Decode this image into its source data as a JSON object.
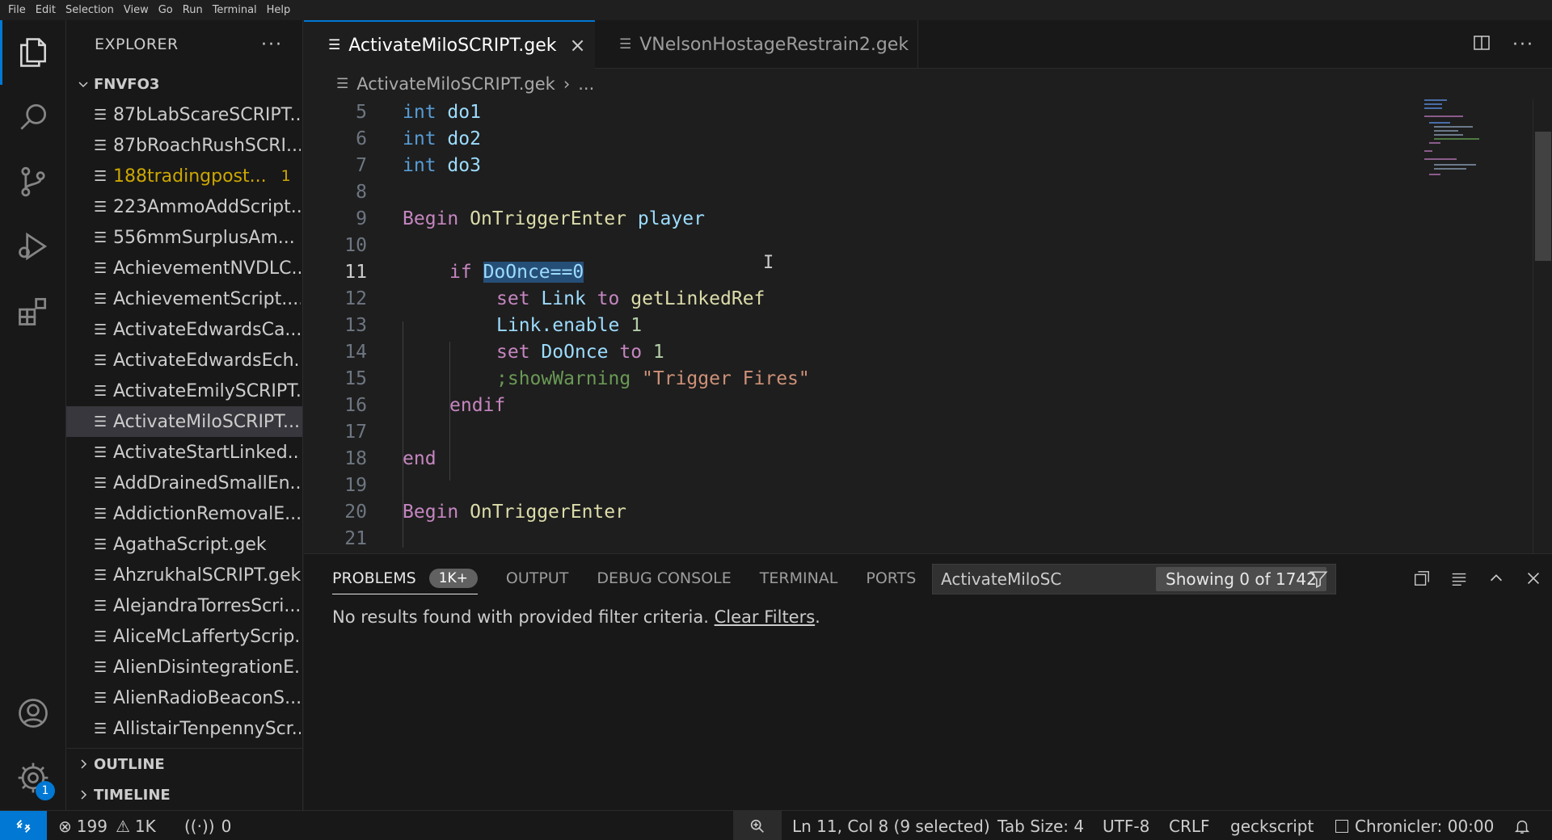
{
  "menu": [
    "File",
    "Edit",
    "Selection",
    "View",
    "Go",
    "Run",
    "Terminal",
    "Help"
  ],
  "activity": {
    "explorer_icon": "files-icon",
    "search_icon": "search-icon",
    "scm_icon": "source-control-icon",
    "debug_icon": "run-debug-icon",
    "extensions_icon": "extensions-icon",
    "account_icon": "account-icon",
    "settings_icon": "gear-icon",
    "settings_badge": "1"
  },
  "sidebar": {
    "title": "EXPLORER",
    "more": "···",
    "folder": "FNVFO3",
    "files": [
      {
        "name": "87bLabScareSCRIPT....",
        "warning": false
      },
      {
        "name": "87bRoachRushSCRI...",
        "warning": false
      },
      {
        "name": "188tradingpost...",
        "warning": true,
        "badge": "1"
      },
      {
        "name": "223AmmoAddScript...",
        "warning": false
      },
      {
        "name": "556mmSurplusAm...",
        "warning": false
      },
      {
        "name": "AchievementNVDLC...",
        "warning": false
      },
      {
        "name": "AchievementScript....",
        "warning": false
      },
      {
        "name": "ActivateEdwardsCa...",
        "warning": false
      },
      {
        "name": "ActivateEdwardsEch...",
        "warning": false
      },
      {
        "name": "ActivateEmilySCRIPT...",
        "warning": false
      },
      {
        "name": "ActivateMiloSCRIPT....",
        "warning": false,
        "selected": true
      },
      {
        "name": "ActivateStartLinked...",
        "warning": false
      },
      {
        "name": "AddDrainedSmallEn...",
        "warning": false
      },
      {
        "name": "AddictionRemovalE...",
        "warning": false
      },
      {
        "name": "AgathaScript.gek",
        "warning": false
      },
      {
        "name": "AhzrukhalSCRIPT.gek",
        "warning": false
      },
      {
        "name": "AlejandraTorresScri...",
        "warning": false
      },
      {
        "name": "AliceMcLaffertyScrip...",
        "warning": false
      },
      {
        "name": "AlienDisintegrationE...",
        "warning": false
      },
      {
        "name": "AlienRadioBeaconS...",
        "warning": false
      },
      {
        "name": "AllistairTenpennyScr...",
        "warning": false
      }
    ],
    "outline": "OUTLINE",
    "timeline": "TIMELINE"
  },
  "tabs": [
    {
      "label": "ActivateMiloSCRIPT.gek",
      "active": true
    },
    {
      "label": "VNelsonHostageRestrain2.gek",
      "active": false
    }
  ],
  "breadcrumb": {
    "file": "ActivateMiloSCRIPT.gek",
    "rest": "..."
  },
  "editor": {
    "lines": [
      "5",
      "6",
      "7",
      "8",
      "9",
      "10",
      "11",
      "12",
      "13",
      "14",
      "15",
      "16",
      "17",
      "18",
      "19",
      "20",
      "21"
    ],
    "t": {
      "int": "int",
      "do1": "do1",
      "do2": "do2",
      "do3": "do3",
      "begin": "Begin",
      "onTriggerEnter": "OnTriggerEnter",
      "player": "player",
      "if": "if",
      "cond": "DoOnce==0",
      "set": "set",
      "link": "Link",
      "to": "to",
      "getLinkedRef": "getLinkedRef",
      "linkEnable": "Link.enable",
      "one": "1",
      "doOnce": "DoOnce",
      "commentKw": ";showWarning",
      "commentStr": "\"Trigger Fires\"",
      "endif": "endif",
      "end": "end"
    }
  },
  "panel": {
    "tabs": [
      "PROBLEMS",
      "OUTPUT",
      "DEBUG CONSOLE",
      "TERMINAL",
      "PORTS"
    ],
    "problems_count": "1K+",
    "filter_value": "ActivateMiloSC",
    "filter_count": "Showing 0 of 1742",
    "message": "No results found with provided filter criteria.",
    "clear_link": "Clear Filters",
    "period": "."
  },
  "status": {
    "errors": "199",
    "warnings": "1K",
    "ports": "0",
    "position": "Ln 11, Col 8 (9 selected)",
    "tab_size": "Tab Size: 4",
    "encoding": "UTF-8",
    "eol": "CRLF",
    "language": "geckscript",
    "chronicler": "Chronicler: 00:00"
  },
  "colors": {
    "accent": "#0078d4",
    "warning": "#cca700",
    "selection": "#264f78"
  }
}
